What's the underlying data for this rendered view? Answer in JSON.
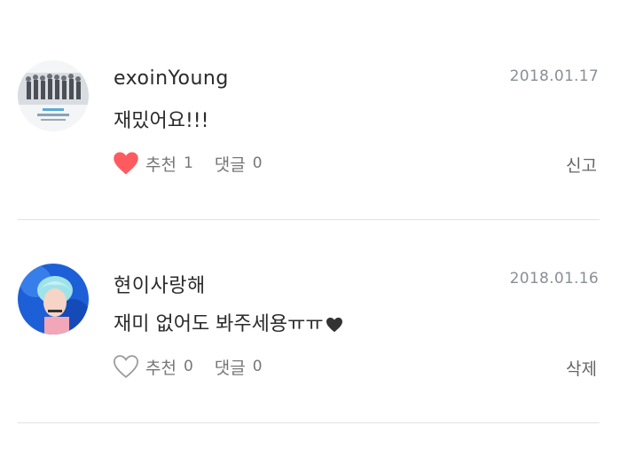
{
  "comments": [
    {
      "username": "exoinYoung",
      "date": "2018.01.17",
      "text": "재밌어요!!!",
      "liked": true,
      "like_label": "추천",
      "like_count": "1",
      "reply_label": "댓글",
      "reply_count": "0",
      "right_action": "신고"
    },
    {
      "username": "현이사랑해",
      "date": "2018.01.16",
      "text": "재미 없어도 봐주세용ㅠㅠ",
      "liked": false,
      "like_label": "추천",
      "like_count": "0",
      "reply_label": "댓글",
      "reply_count": "0",
      "right_action": "삭제"
    }
  ],
  "colors": {
    "heart_active": "#ff5a5f",
    "heart_inactive": "#9a9a9a",
    "divider": "#e2e2e2"
  }
}
